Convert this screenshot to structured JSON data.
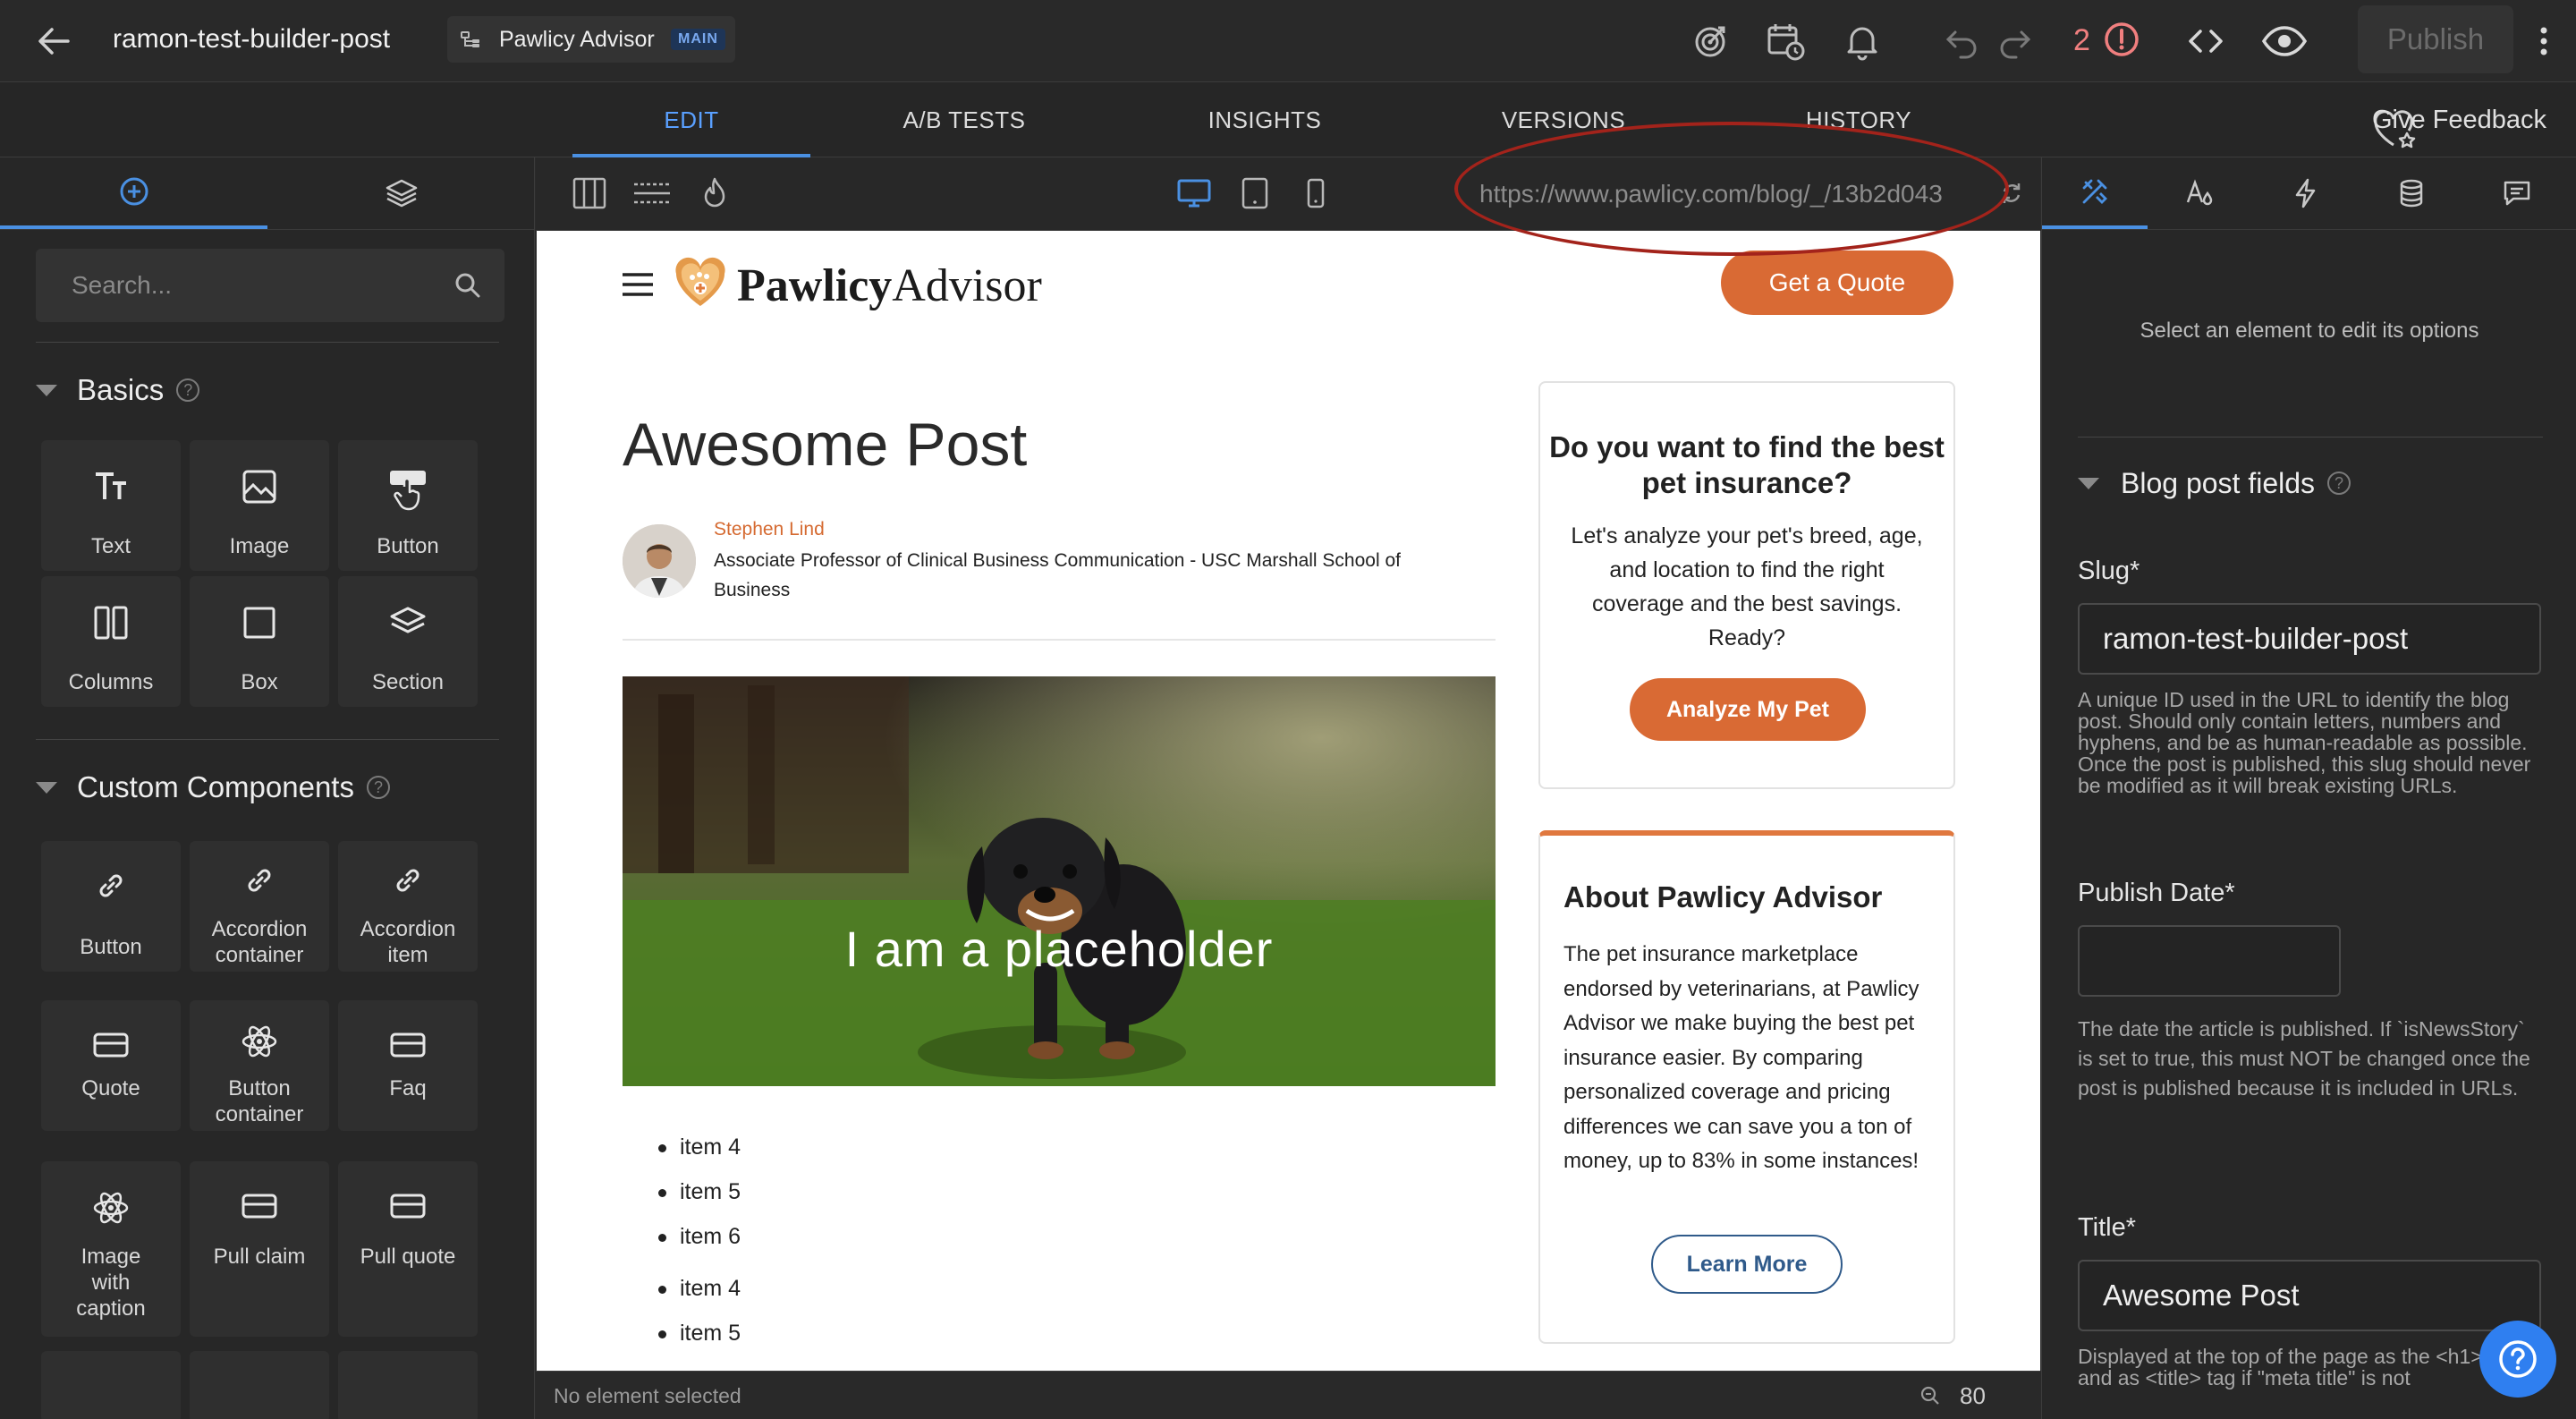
{
  "top_bar": {
    "post_name": "ramon-test-builder-post",
    "site_name": "Pawlicy Advisor",
    "branch_badge": "MAIN",
    "issue_count": "2",
    "publish_label": "Publish",
    "icons": [
      "back-arrow-icon",
      "target-icon",
      "calendar-clock-icon",
      "bell-icon",
      "undo-icon",
      "redo-icon",
      "alert-icon",
      "code-icon",
      "eye-icon",
      "more-vertical-icon"
    ]
  },
  "main_tabs": [
    {
      "label": "EDIT",
      "active": true
    },
    {
      "label": "A/B TESTS",
      "active": false
    },
    {
      "label": "INSIGHTS",
      "active": false
    },
    {
      "label": "VERSIONS",
      "active": false
    },
    {
      "label": "HISTORY",
      "active": false
    }
  ],
  "give_feedback": "Give Feedback",
  "left_panel": {
    "search_placeholder": "Search...",
    "basics": {
      "title": "Basics",
      "items": [
        {
          "label": "Text",
          "icon": "text-icon"
        },
        {
          "label": "Image",
          "icon": "image-icon"
        },
        {
          "label": "Button",
          "icon": "button-click-icon"
        },
        {
          "label": "Columns",
          "icon": "columns-icon"
        },
        {
          "label": "Box",
          "icon": "box-icon"
        },
        {
          "label": "Section",
          "icon": "layers-icon"
        }
      ]
    },
    "custom": {
      "title": "Custom Components",
      "items": [
        {
          "label": "Button",
          "icon": "link-icon"
        },
        {
          "label": "Accordion container",
          "icon": "link-icon"
        },
        {
          "label": "Accordion item",
          "icon": "link-icon"
        },
        {
          "label": "Quote",
          "icon": "card-icon"
        },
        {
          "label": "Button container",
          "icon": "atom-icon"
        },
        {
          "label": "Faq",
          "icon": "card-icon"
        },
        {
          "label": "Image with caption",
          "icon": "atom-icon"
        },
        {
          "label": "Pull claim",
          "icon": "card-icon"
        },
        {
          "label": "Pull quote",
          "icon": "card-icon"
        }
      ]
    }
  },
  "canvas_toolbar": {
    "url": "https://www.pawlicy.com/blog/_/13b2d043",
    "active_device": "desktop"
  },
  "canvas": {
    "logo_bold": "Pawlicy",
    "logo_rest": "Advisor",
    "cta": "Get a Quote",
    "post_title": "Awesome Post",
    "author_name": "Stephen Lind",
    "author_role": "Associate Professor of Clinical Business Communication - USC Marshall School of Business",
    "hero_caption": "I am a placeholder",
    "list_items": [
      "item 4",
      "item 5",
      "item 6",
      "item 4",
      "item 5"
    ],
    "insurance_card": {
      "title": "Do you want to find the best pet insurance?",
      "body": "Let's analyze your pet's breed, age, and location to find the right coverage and the best savings. Ready?",
      "button": "Analyze My Pet"
    },
    "about_card": {
      "title": "About Pawlicy Advisor",
      "body": "The pet insurance marketplace endorsed by veterinarians, at Pawlicy Advisor we make buying the best pet insurance easier. By comparing personalized coverage and pricing differences we can save you a ton of money, up to 83% in some instances!",
      "button": "Learn More"
    },
    "colors": {
      "brand_orange": "#d96a34",
      "link_blue": "#2f5a8a"
    }
  },
  "status_bar": {
    "text": "No element selected",
    "zoom": "80"
  },
  "right_panel": {
    "hint": "Select an element to edit its options",
    "section_title": "Blog post fields",
    "slug_label": "Slug*",
    "slug_value": "ramon-test-builder-post",
    "slug_help": "A unique ID used in the URL to identify the blog post. Should only contain letters, numbers and hyphens, and be as human-readable as possible. Once the post is published, this slug should never be modified as it will break existing URLs.",
    "publish_date_label": "Publish Date*",
    "publish_date_value": "",
    "publish_date_help": "The date the article is published. If `isNewsStory` is set to true, this must NOT be changed once the post is published because it is included in URLs.",
    "title_label": "Title*",
    "title_value": "Awesome Post",
    "title_help": "Displayed at the top of the page as the <h1> tag and as <title> tag if \"meta title\" is not"
  },
  "accent_color": "#4a90e2"
}
